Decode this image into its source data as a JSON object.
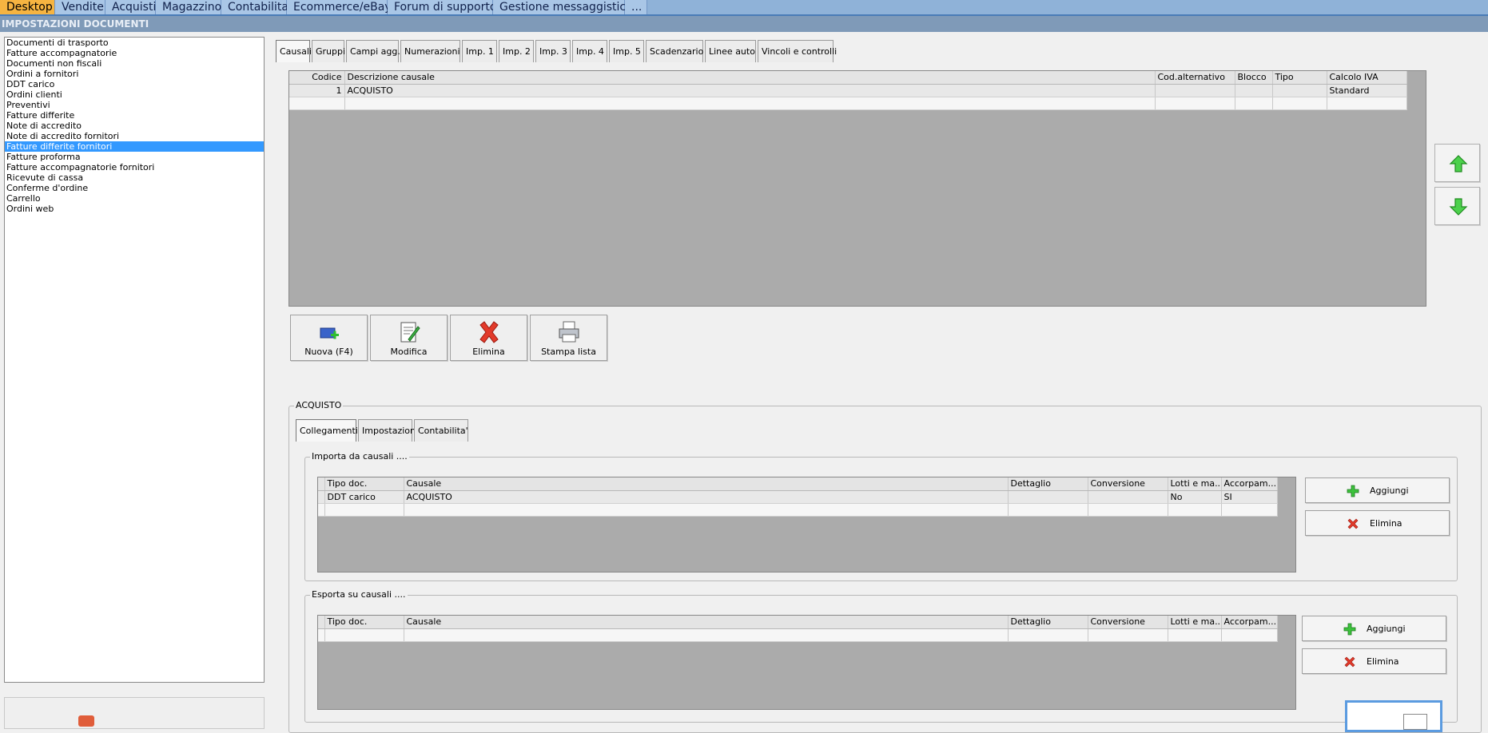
{
  "menu": {
    "tabs": [
      "Desktop",
      "Vendite",
      "Acquisti",
      "Magazzino",
      "Contabilita'",
      "Ecommerce/eBay",
      "Forum di supporto",
      "Gestione messaggistica",
      "..."
    ]
  },
  "subtitle": "IMPOSTAZIONI DOCUMENTI",
  "doc_list": {
    "items": [
      "Documenti di trasporto",
      "Fatture accompagnatorie",
      "Documenti non fiscali",
      "Ordini a fornitori",
      "DDT carico",
      "Ordini clienti",
      "Preventivi",
      "Fatture differite",
      "Note di accredito",
      "Note di accredito fornitori",
      "Fatture differite fornitori",
      "Fatture proforma",
      "Fatture accompagnatorie fornitori",
      "Ricevute di cassa",
      "Conferme d'ordine",
      "Carrello",
      "Ordini web"
    ],
    "selected": "Fatture differite fornitori"
  },
  "main_tabs": [
    "Causali",
    "Gruppi",
    "Campi agg.",
    "Numerazioni",
    "Imp. 1",
    "Imp. 2",
    "Imp. 3",
    "Imp. 4",
    "Imp. 5",
    "Scadenzario",
    "Linee auto",
    "Vincoli e controlli"
  ],
  "causali_grid": {
    "columns": [
      "Codice",
      "Descrizione causale",
      "Cod.alternativo",
      "Blocco",
      "Tipo",
      "Calcolo IVA"
    ],
    "rows": [
      [
        "1",
        "ACQUISTO",
        "",
        "",
        "",
        "Standard"
      ]
    ]
  },
  "actions": {
    "new": "Nuova (F4)",
    "edit": "Modifica",
    "delete": "Elimina",
    "print": "Stampa lista"
  },
  "detail": {
    "title": "ACQUISTO",
    "tabs": [
      "Collegamenti",
      "Impostazioni",
      "Contabilita'"
    ],
    "import_group": {
      "legend": "Importa da causali ....",
      "columns": [
        "Tipo doc.",
        "Causale",
        "Dettaglio",
        "Conversione",
        "Lotti e ma...",
        "Accorpam..."
      ],
      "rows": [
        [
          "DDT carico",
          "ACQUISTO",
          "",
          "",
          "No",
          "SI"
        ]
      ],
      "add_label": "Aggiungi",
      "delete_label": "Elimina"
    },
    "export_group": {
      "legend": "Esporta su causali ....",
      "columns": [
        "Tipo doc.",
        "Causale",
        "Dettaglio",
        "Conversione",
        "Lotti e ma...",
        "Accorpam..."
      ],
      "rows": [],
      "add_label": "Aggiungi",
      "delete_label": "Elimina"
    }
  },
  "colors": {
    "menu_active": "#f6b441",
    "menu_bg": "#8fb2d8",
    "selection": "#3399ff",
    "grid_bg": "#ababab"
  }
}
